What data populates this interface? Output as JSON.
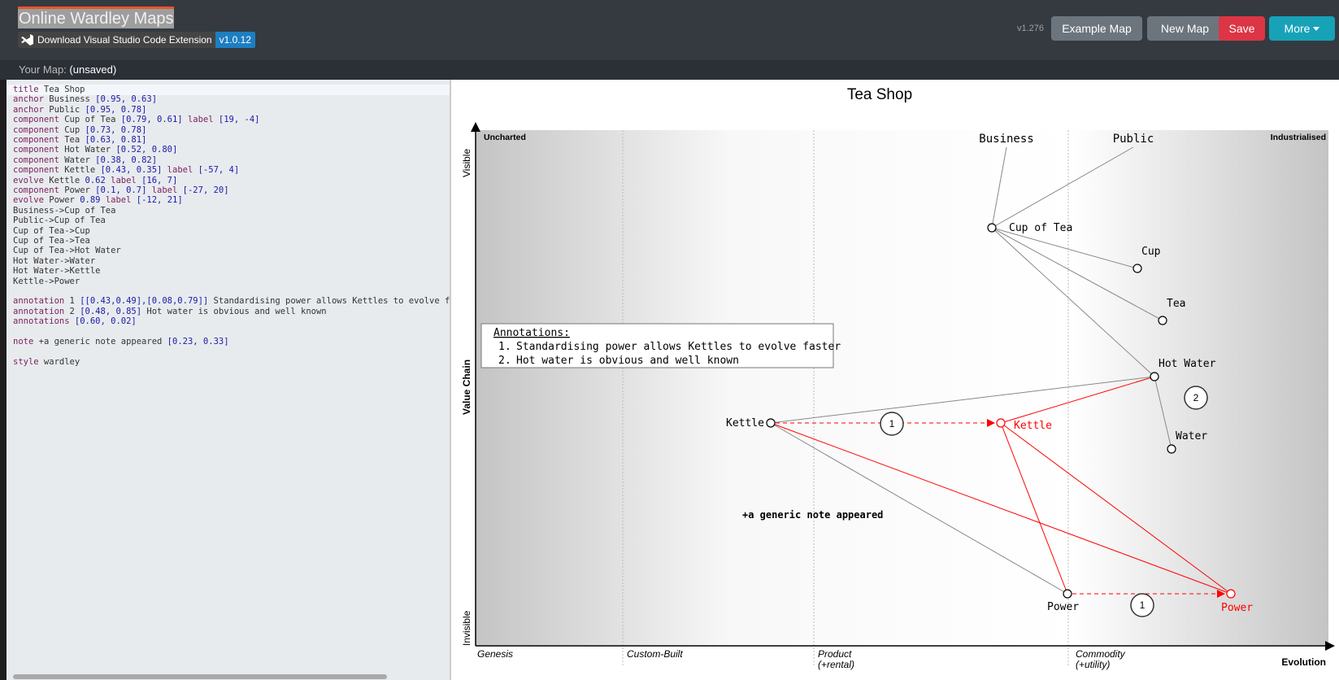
{
  "app": {
    "title": "Online Wardley Maps",
    "version": "v1.276"
  },
  "extension": {
    "label": "Download Visual Studio Code Extension",
    "version": "v1.0.12"
  },
  "toolbar": {
    "example_label": "Example Map",
    "new_label": "New Map",
    "save_label": "Save",
    "more_label": "More"
  },
  "map_name": {
    "label": "Your Map:",
    "value": "(unsaved)"
  },
  "editor": {
    "lines": [
      [
        [
          "kw",
          "title"
        ],
        [
          "t",
          " Tea Shop"
        ]
      ],
      [
        [
          "kw",
          "anchor"
        ],
        [
          "t",
          " Business "
        ],
        [
          "num",
          "[0.95, 0.63]"
        ]
      ],
      [
        [
          "kw",
          "anchor"
        ],
        [
          "t",
          " Public "
        ],
        [
          "num",
          "[0.95, 0.78]"
        ]
      ],
      [
        [
          "kw",
          "component"
        ],
        [
          "t",
          " Cup of Tea "
        ],
        [
          "num",
          "[0.79, 0.61]"
        ],
        [
          "t",
          " "
        ],
        [
          "kw",
          "label"
        ],
        [
          "t",
          " "
        ],
        [
          "num",
          "[19, -4]"
        ]
      ],
      [
        [
          "kw",
          "component"
        ],
        [
          "t",
          " Cup "
        ],
        [
          "num",
          "[0.73, 0.78]"
        ]
      ],
      [
        [
          "kw",
          "component"
        ],
        [
          "t",
          " Tea "
        ],
        [
          "num",
          "[0.63, 0.81]"
        ]
      ],
      [
        [
          "kw",
          "component"
        ],
        [
          "t",
          " Hot Water "
        ],
        [
          "num",
          "[0.52, 0.80]"
        ]
      ],
      [
        [
          "kw",
          "component"
        ],
        [
          "t",
          " Water "
        ],
        [
          "num",
          "[0.38, 0.82]"
        ]
      ],
      [
        [
          "kw",
          "component"
        ],
        [
          "t",
          " Kettle "
        ],
        [
          "num",
          "[0.43, 0.35]"
        ],
        [
          "t",
          " "
        ],
        [
          "kw",
          "label"
        ],
        [
          "t",
          " "
        ],
        [
          "num",
          "[-57, 4]"
        ]
      ],
      [
        [
          "kw",
          "evolve"
        ],
        [
          "t",
          " Kettle "
        ],
        [
          "num",
          "0.62"
        ],
        [
          "t",
          " "
        ],
        [
          "kw",
          "label"
        ],
        [
          "t",
          " "
        ],
        [
          "num",
          "[16, 7]"
        ]
      ],
      [
        [
          "kw",
          "component"
        ],
        [
          "t",
          " Power "
        ],
        [
          "num",
          "[0.1, 0.7]"
        ],
        [
          "t",
          " "
        ],
        [
          "kw",
          "label"
        ],
        [
          "t",
          " "
        ],
        [
          "num",
          "[-27, 20]"
        ]
      ],
      [
        [
          "kw",
          "evolve"
        ],
        [
          "t",
          " Power "
        ],
        [
          "num",
          "0.89"
        ],
        [
          "t",
          " "
        ],
        [
          "kw",
          "label"
        ],
        [
          "t",
          " "
        ],
        [
          "num",
          "[-12, 21]"
        ]
      ],
      [
        [
          "t",
          "Business->Cup of Tea"
        ]
      ],
      [
        [
          "t",
          "Public->Cup of Tea"
        ]
      ],
      [
        [
          "t",
          "Cup of Tea->Cup"
        ]
      ],
      [
        [
          "t",
          "Cup of Tea->Tea"
        ]
      ],
      [
        [
          "t",
          "Cup of Tea->Hot Water"
        ]
      ],
      [
        [
          "t",
          "Hot Water->Water"
        ]
      ],
      [
        [
          "t",
          "Hot Water->Kettle"
        ]
      ],
      [
        [
          "t",
          "Kettle->Power"
        ]
      ],
      [
        [
          "t",
          ""
        ]
      ],
      [
        [
          "kw",
          "annotation"
        ],
        [
          "t",
          " 1 "
        ],
        [
          "num",
          "[[0.43,0.49],[0.08,0.79]]"
        ],
        [
          "t",
          " Standardising power allows Kettles to evolve faste"
        ]
      ],
      [
        [
          "kw",
          "annotation"
        ],
        [
          "t",
          " 2 "
        ],
        [
          "num",
          "[0.48, 0.85]"
        ],
        [
          "t",
          " Hot water is obvious and well known"
        ]
      ],
      [
        [
          "kw",
          "annotations"
        ],
        [
          "t",
          " "
        ],
        [
          "num",
          "[0.60, 0.02]"
        ]
      ],
      [
        [
          "t",
          ""
        ]
      ],
      [
        [
          "kw",
          "note"
        ],
        [
          "t",
          " +a generic note appeared "
        ],
        [
          "num",
          "[0.23, 0.33]"
        ]
      ],
      [
        [
          "t",
          ""
        ]
      ],
      [
        [
          "kw",
          "style"
        ],
        [
          "t",
          " wardley"
        ]
      ]
    ]
  },
  "map": {
    "title": "Tea Shop",
    "y_axis": {
      "label": "Value Chain",
      "top": "Visible",
      "bottom": "Invisible"
    },
    "x_axis": {
      "label": "Evolution",
      "stages": [
        {
          "line1": "Genesis",
          "line2": ""
        },
        {
          "line1": "Custom-Built",
          "line2": ""
        },
        {
          "line1": "Product",
          "line2": "(+rental)"
        },
        {
          "line1": "Commodity",
          "line2": "(+utility)"
        }
      ]
    },
    "corner_labels": {
      "left": "Uncharted",
      "right": "Industrialised"
    },
    "anchors": [
      "Business",
      "Public"
    ],
    "components": [
      "Cup of Tea",
      "Cup",
      "Tea",
      "Hot Water",
      "Water",
      "Kettle",
      "Power"
    ],
    "evolved": [
      "Kettle",
      "Power"
    ],
    "annotation_markers": [
      "1",
      "1",
      "2"
    ],
    "annotations_box": {
      "title": "Annotations:",
      "items": [
        "Standardising power allows Kettles to evolve faster",
        "Hot water is obvious and well known"
      ]
    },
    "note": "+a generic note appeared",
    "colors": {
      "component": "#000000",
      "evolved": "#ff0000",
      "link": "#888888"
    }
  }
}
